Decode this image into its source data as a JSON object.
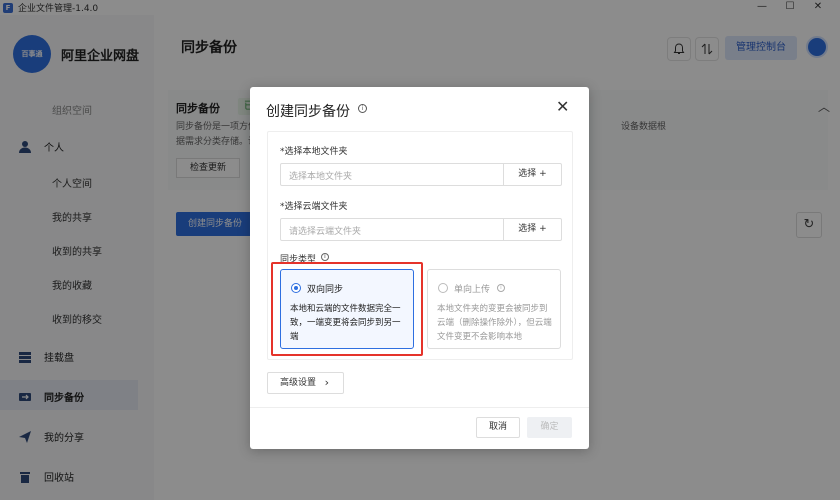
{
  "window": {
    "title": "企业文件管理-1.4.0",
    "app_icon": "F",
    "controls": [
      "—",
      "☐",
      "✕"
    ]
  },
  "brand": {
    "logo_text": "百事通",
    "name": "阿里企业网盘"
  },
  "sidebar": {
    "partial_top": "组织空间",
    "personal_label": "个人",
    "sub_items": [
      "个人空间",
      "我的共享",
      "收到的共享",
      "我的收藏",
      "收到的移交"
    ],
    "main_items": [
      {
        "label": "挂载盘",
        "icon": "mount-icon"
      },
      {
        "label": "同步备份",
        "icon": "sync-icon",
        "active": true
      },
      {
        "label": "我的分享",
        "icon": "share-icon"
      },
      {
        "label": "回收站",
        "icon": "trash-icon"
      }
    ]
  },
  "header": {
    "page_title": "同步备份",
    "admin_button": "管理控制台"
  },
  "info_card": {
    "title": "同步备份",
    "badge": "已",
    "text_line1": "同步备份是一项方便",
    "text_line1_right": "设备数据根",
    "text_line2": "据需求分类存储。说",
    "check_update": "检查更新"
  },
  "create_backup_button": "创建同步备份",
  "dialog": {
    "title": "创建同步备份",
    "local_label": "*选择本地文件夹",
    "local_placeholder": "选择本地文件夹",
    "local_select": "选择 +",
    "cloud_label": "*选择云端文件夹",
    "cloud_placeholder": "请选择云端文件夹",
    "cloud_select": "选择 +",
    "sync_type_label": "同步类型",
    "options": [
      {
        "title": "双向同步",
        "desc": "本地和云端的文件数据完全一致，一端变更将会同步到另一端",
        "selected": true
      },
      {
        "title": "单向上传",
        "desc": "本地文件夹的变更会被同步到云端（删除操作除外），但云端文件变更不会影响本地",
        "selected": false
      }
    ],
    "advanced": "高级设置",
    "cancel": "取消",
    "ok": "确定"
  },
  "colors": {
    "primary": "#2e6fe0",
    "highlight": "#e5332a"
  }
}
